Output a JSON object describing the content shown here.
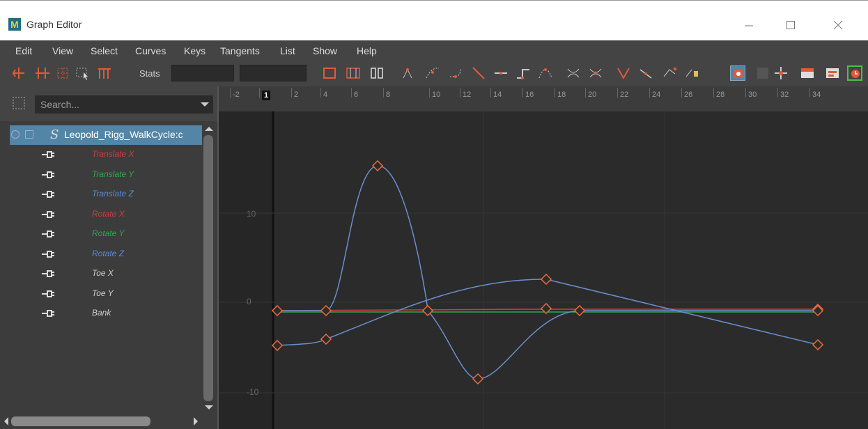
{
  "window": {
    "title": "Graph Editor",
    "app_icon": "M"
  },
  "menu": [
    "Edit",
    "View",
    "Select",
    "Curves",
    "Keys",
    "Tangents",
    "List",
    "Show",
    "Help"
  ],
  "toolbar": {
    "stats_label": "Stats"
  },
  "outliner": {
    "search_placeholder": "Search...",
    "node": "Leopold_Rigg_WalkCycle:c",
    "attributes": [
      {
        "label": "Translate X",
        "color": "#d23c3c"
      },
      {
        "label": "Translate Y",
        "color": "#2ea84a"
      },
      {
        "label": "Translate Z",
        "color": "#5b8ad6"
      },
      {
        "label": "Rotate X",
        "color": "#d23c3c"
      },
      {
        "label": "Rotate Y",
        "color": "#2ea84a"
      },
      {
        "label": "Rotate Z",
        "color": "#5b8ad6"
      },
      {
        "label": "Toe X",
        "color": "#cfcfcf"
      },
      {
        "label": "Toe Y",
        "color": "#cfcfcf"
      },
      {
        "label": "Bank",
        "color": "#cfcfcf"
      }
    ]
  },
  "graph": {
    "ruler_labels": [
      "-2",
      "1",
      "2",
      "4",
      "6",
      "8",
      "10",
      "12",
      "14",
      "16",
      "18",
      "20",
      "22",
      "24",
      "26",
      "28",
      "30",
      "32",
      "34"
    ],
    "current_frame": "1",
    "y_labels": [
      "10",
      "0",
      "-10"
    ]
  }
}
